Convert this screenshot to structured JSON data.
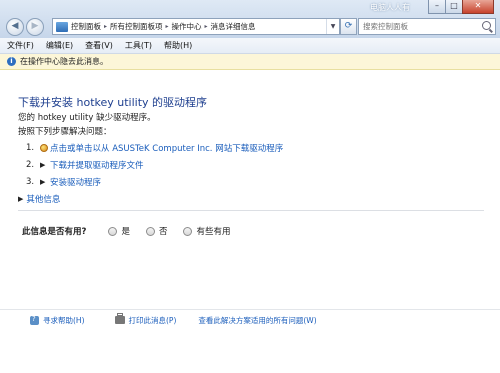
{
  "window": {
    "watermark": "电脑人人有",
    "minimize": "–",
    "maximize": "□",
    "close": "✕"
  },
  "nav": {
    "back": "◀",
    "forward": "▶",
    "refresh": "⟳"
  },
  "address": {
    "breadcrumbs": [
      "控制面板",
      "所有控制面板项",
      "操作中心",
      "消息详细信息"
    ],
    "separator": "▸"
  },
  "search": {
    "placeholder": "搜索控制面板"
  },
  "menu": {
    "items": [
      "文件(F)",
      "编辑(E)",
      "查看(V)",
      "工具(T)",
      "帮助(H)"
    ]
  },
  "infobar": {
    "text": "在操作中心隐去此消息。"
  },
  "content": {
    "heading": "下载并安装 hotkey utility 的驱动程序",
    "desc1": "您的 hotkey utility 缺少驱动程序。",
    "desc2": "按照下列步骤解决问题：",
    "steps": [
      {
        "num": "1.",
        "label": "点击或单击以从 ASUSTeK Computer Inc. 网站下载驱动程序"
      },
      {
        "num": "2.",
        "label": "下载并提取驱动程序文件"
      },
      {
        "num": "3.",
        "label": "安装驱动程序"
      }
    ],
    "more": "其他信息"
  },
  "feedback": {
    "question": "此信息是否有用?",
    "options": [
      "是",
      "否",
      "有些有用"
    ]
  },
  "bottom": {
    "links": [
      "寻求帮助(H)",
      "打印此消息(P)",
      "查看此解决方案适用的所有问题(W)"
    ]
  },
  "icons": {
    "info": "info-icon",
    "globe": "globe-icon",
    "help": "help-icon",
    "printer": "printer-icon"
  }
}
